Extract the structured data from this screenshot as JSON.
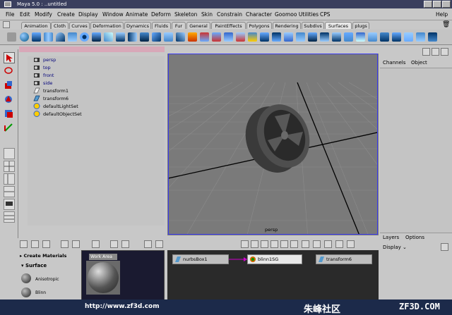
{
  "window": {
    "title": "Maya 5.0 : ..untitled"
  },
  "menu": [
    {
      "label": "File"
    },
    {
      "label": "Edit"
    },
    {
      "label": "Modify"
    },
    {
      "label": "Create"
    },
    {
      "label": "Display"
    },
    {
      "label": "Window"
    },
    {
      "label": "Animate"
    },
    {
      "label": "Deform"
    },
    {
      "label": "Skeleton"
    },
    {
      "label": "Skin"
    },
    {
      "label": "Constrain"
    },
    {
      "label": "Character"
    },
    {
      "label": "Goomoo Utilities"
    },
    {
      "label": "CPS"
    },
    {
      "label": "Help"
    }
  ],
  "shelf_tabs": [
    {
      "label": "Animation"
    },
    {
      "label": "Cloth"
    },
    {
      "label": "Curves"
    },
    {
      "label": "Deformation"
    },
    {
      "label": "Dynamics"
    },
    {
      "label": "Fluids"
    },
    {
      "label": "Fur"
    },
    {
      "label": "General"
    },
    {
      "label": "PaintEffects"
    },
    {
      "label": "Polygons"
    },
    {
      "label": "Rendering"
    },
    {
      "label": "Subdivs"
    },
    {
      "label": "Surfaces"
    },
    {
      "label": "plugs"
    }
  ],
  "active_shelf_tab": "Surfaces",
  "outliner": {
    "items": [
      {
        "label": "persp",
        "icon": "camera-icon",
        "kind": "camera"
      },
      {
        "label": "top",
        "icon": "camera-icon",
        "kind": "camera"
      },
      {
        "label": "front",
        "icon": "camera-icon",
        "kind": "camera"
      },
      {
        "label": "side",
        "icon": "camera-icon",
        "kind": "camera"
      },
      {
        "label": "transform1",
        "icon": "transform-icon",
        "kind": "node"
      },
      {
        "label": "transform6",
        "icon": "curve-icon",
        "kind": "node"
      },
      {
        "label": "defaultLightSet",
        "icon": "set-icon",
        "kind": "node"
      },
      {
        "label": "defaultObjectSet",
        "icon": "set-icon",
        "kind": "node"
      }
    ]
  },
  "viewport": {
    "camera_label": "persp"
  },
  "channel_box": {
    "tab_channels": "Channels",
    "tab_object": "Object"
  },
  "layers": {
    "tab_layers": "Layers",
    "tab_options": "Options",
    "display_label": "Display"
  },
  "hypershade": {
    "create_label": "Create Materials",
    "section": "Surface",
    "materials": [
      {
        "label": "Anisotropic"
      },
      {
        "label": "Blinn"
      }
    ],
    "work_area_tab": "Work Area",
    "nodes": [
      {
        "label": "nurbsBox1"
      },
      {
        "label": "blinn1SG"
      },
      {
        "label": "transform6"
      }
    ]
  },
  "footer": {
    "url": "http://www.zf3d.com",
    "cn": "朱峰社区",
    "domain": "ZF3D.COM"
  }
}
